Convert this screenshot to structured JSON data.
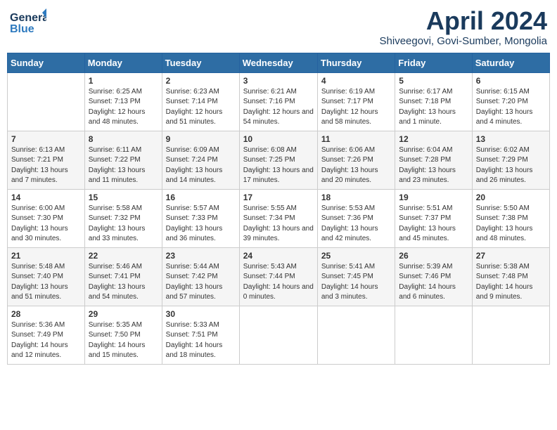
{
  "header": {
    "logo_general": "General",
    "logo_blue": "Blue",
    "month_title": "April 2024",
    "location": "Shiveegovi, Govi-Sumber, Mongolia"
  },
  "days_of_week": [
    "Sunday",
    "Monday",
    "Tuesday",
    "Wednesday",
    "Thursday",
    "Friday",
    "Saturday"
  ],
  "weeks": [
    [
      {
        "day": "",
        "sunrise": "",
        "sunset": "",
        "daylight": ""
      },
      {
        "day": "1",
        "sunrise": "Sunrise: 6:25 AM",
        "sunset": "Sunset: 7:13 PM",
        "daylight": "Daylight: 12 hours and 48 minutes."
      },
      {
        "day": "2",
        "sunrise": "Sunrise: 6:23 AM",
        "sunset": "Sunset: 7:14 PM",
        "daylight": "Daylight: 12 hours and 51 minutes."
      },
      {
        "day": "3",
        "sunrise": "Sunrise: 6:21 AM",
        "sunset": "Sunset: 7:16 PM",
        "daylight": "Daylight: 12 hours and 54 minutes."
      },
      {
        "day": "4",
        "sunrise": "Sunrise: 6:19 AM",
        "sunset": "Sunset: 7:17 PM",
        "daylight": "Daylight: 12 hours and 58 minutes."
      },
      {
        "day": "5",
        "sunrise": "Sunrise: 6:17 AM",
        "sunset": "Sunset: 7:18 PM",
        "daylight": "Daylight: 13 hours and 1 minute."
      },
      {
        "day": "6",
        "sunrise": "Sunrise: 6:15 AM",
        "sunset": "Sunset: 7:20 PM",
        "daylight": "Daylight: 13 hours and 4 minutes."
      }
    ],
    [
      {
        "day": "7",
        "sunrise": "Sunrise: 6:13 AM",
        "sunset": "Sunset: 7:21 PM",
        "daylight": "Daylight: 13 hours and 7 minutes."
      },
      {
        "day": "8",
        "sunrise": "Sunrise: 6:11 AM",
        "sunset": "Sunset: 7:22 PM",
        "daylight": "Daylight: 13 hours and 11 minutes."
      },
      {
        "day": "9",
        "sunrise": "Sunrise: 6:09 AM",
        "sunset": "Sunset: 7:24 PM",
        "daylight": "Daylight: 13 hours and 14 minutes."
      },
      {
        "day": "10",
        "sunrise": "Sunrise: 6:08 AM",
        "sunset": "Sunset: 7:25 PM",
        "daylight": "Daylight: 13 hours and 17 minutes."
      },
      {
        "day": "11",
        "sunrise": "Sunrise: 6:06 AM",
        "sunset": "Sunset: 7:26 PM",
        "daylight": "Daylight: 13 hours and 20 minutes."
      },
      {
        "day": "12",
        "sunrise": "Sunrise: 6:04 AM",
        "sunset": "Sunset: 7:28 PM",
        "daylight": "Daylight: 13 hours and 23 minutes."
      },
      {
        "day": "13",
        "sunrise": "Sunrise: 6:02 AM",
        "sunset": "Sunset: 7:29 PM",
        "daylight": "Daylight: 13 hours and 26 minutes."
      }
    ],
    [
      {
        "day": "14",
        "sunrise": "Sunrise: 6:00 AM",
        "sunset": "Sunset: 7:30 PM",
        "daylight": "Daylight: 13 hours and 30 minutes."
      },
      {
        "day": "15",
        "sunrise": "Sunrise: 5:58 AM",
        "sunset": "Sunset: 7:32 PM",
        "daylight": "Daylight: 13 hours and 33 minutes."
      },
      {
        "day": "16",
        "sunrise": "Sunrise: 5:57 AM",
        "sunset": "Sunset: 7:33 PM",
        "daylight": "Daylight: 13 hours and 36 minutes."
      },
      {
        "day": "17",
        "sunrise": "Sunrise: 5:55 AM",
        "sunset": "Sunset: 7:34 PM",
        "daylight": "Daylight: 13 hours and 39 minutes."
      },
      {
        "day": "18",
        "sunrise": "Sunrise: 5:53 AM",
        "sunset": "Sunset: 7:36 PM",
        "daylight": "Daylight: 13 hours and 42 minutes."
      },
      {
        "day": "19",
        "sunrise": "Sunrise: 5:51 AM",
        "sunset": "Sunset: 7:37 PM",
        "daylight": "Daylight: 13 hours and 45 minutes."
      },
      {
        "day": "20",
        "sunrise": "Sunrise: 5:50 AM",
        "sunset": "Sunset: 7:38 PM",
        "daylight": "Daylight: 13 hours and 48 minutes."
      }
    ],
    [
      {
        "day": "21",
        "sunrise": "Sunrise: 5:48 AM",
        "sunset": "Sunset: 7:40 PM",
        "daylight": "Daylight: 13 hours and 51 minutes."
      },
      {
        "day": "22",
        "sunrise": "Sunrise: 5:46 AM",
        "sunset": "Sunset: 7:41 PM",
        "daylight": "Daylight: 13 hours and 54 minutes."
      },
      {
        "day": "23",
        "sunrise": "Sunrise: 5:44 AM",
        "sunset": "Sunset: 7:42 PM",
        "daylight": "Daylight: 13 hours and 57 minutes."
      },
      {
        "day": "24",
        "sunrise": "Sunrise: 5:43 AM",
        "sunset": "Sunset: 7:44 PM",
        "daylight": "Daylight: 14 hours and 0 minutes."
      },
      {
        "day": "25",
        "sunrise": "Sunrise: 5:41 AM",
        "sunset": "Sunset: 7:45 PM",
        "daylight": "Daylight: 14 hours and 3 minutes."
      },
      {
        "day": "26",
        "sunrise": "Sunrise: 5:39 AM",
        "sunset": "Sunset: 7:46 PM",
        "daylight": "Daylight: 14 hours and 6 minutes."
      },
      {
        "day": "27",
        "sunrise": "Sunrise: 5:38 AM",
        "sunset": "Sunset: 7:48 PM",
        "daylight": "Daylight: 14 hours and 9 minutes."
      }
    ],
    [
      {
        "day": "28",
        "sunrise": "Sunrise: 5:36 AM",
        "sunset": "Sunset: 7:49 PM",
        "daylight": "Daylight: 14 hours and 12 minutes."
      },
      {
        "day": "29",
        "sunrise": "Sunrise: 5:35 AM",
        "sunset": "Sunset: 7:50 PM",
        "daylight": "Daylight: 14 hours and 15 minutes."
      },
      {
        "day": "30",
        "sunrise": "Sunrise: 5:33 AM",
        "sunset": "Sunset: 7:51 PM",
        "daylight": "Daylight: 14 hours and 18 minutes."
      },
      {
        "day": "",
        "sunrise": "",
        "sunset": "",
        "daylight": ""
      },
      {
        "day": "",
        "sunrise": "",
        "sunset": "",
        "daylight": ""
      },
      {
        "day": "",
        "sunrise": "",
        "sunset": "",
        "daylight": ""
      },
      {
        "day": "",
        "sunrise": "",
        "sunset": "",
        "daylight": ""
      }
    ]
  ]
}
